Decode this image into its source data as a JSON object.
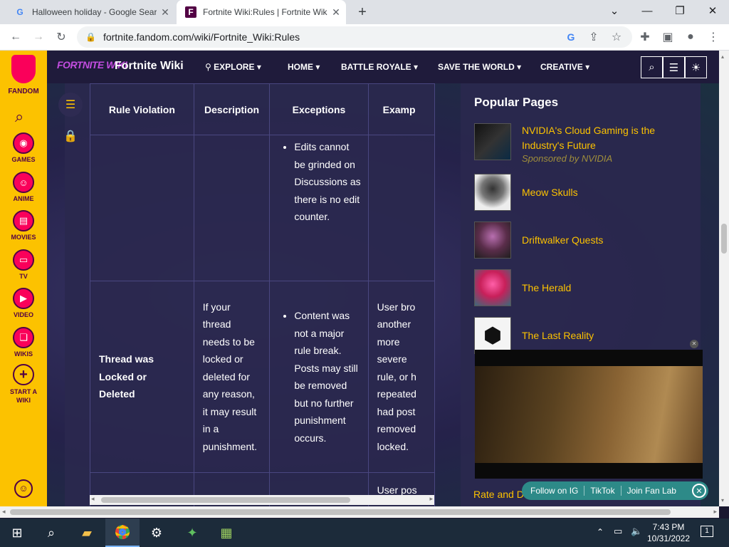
{
  "browser": {
    "tabs": [
      {
        "label": "Halloween holiday - Google Sear",
        "icon": "G"
      },
      {
        "label": "Fortnite Wiki:Rules | Fortnite Wik",
        "icon": "F"
      }
    ],
    "new_tab": "+",
    "url": "fortnite.fandom.com/wiki/Fortnite_Wiki:Rules"
  },
  "fandom_rail": {
    "logo_label": "FANDOM",
    "items": [
      {
        "label": "GAMES",
        "icon": "gamepad-icon"
      },
      {
        "label": "ANIME",
        "icon": "anime-icon"
      },
      {
        "label": "MOVIES",
        "icon": "film-icon"
      },
      {
        "label": "TV",
        "icon": "tv-icon"
      },
      {
        "label": "VIDEO",
        "icon": "play-icon"
      },
      {
        "label": "WIKIS",
        "icon": "book-icon"
      },
      {
        "label": "START A WIKI",
        "icon": "plus-icon"
      }
    ]
  },
  "wiki_header": {
    "logo_text": "FORTNITE WIKI",
    "title": "Fortnite Wiki",
    "nav": [
      "EXPLORE",
      "HOME",
      "BATTLE ROYALE",
      "SAVE THE WORLD",
      "CREATIVE"
    ]
  },
  "table": {
    "headers": [
      "Rule Violation",
      "Description",
      "Exceptions",
      "Examp"
    ],
    "row1": {
      "exceptions": [
        "Edits cannot be grinded on Discussions as there is no edit counter."
      ]
    },
    "row2": {
      "violation": "Thread was Locked or Deleted",
      "description": "If your thread needs to be locked or deleted for any reason, it may result in a punishment.",
      "exceptions": [
        "Content was not a major rule break. Posts may still be removed but no further punishment occurs."
      ],
      "example": "User bro another more severe rule, or h repeated had post removed locked."
    },
    "row3": {
      "example": "User pos"
    }
  },
  "popular": {
    "title": "Popular Pages",
    "items": [
      {
        "title": "NVIDIA's Cloud Gaming is the Industry's Future",
        "sponsor": "Sponsored by NVIDIA"
      },
      {
        "title": "Meow Skulls"
      },
      {
        "title": "Driftwalker Quests"
      },
      {
        "title": "The Herald"
      },
      {
        "title": "The Last Reality"
      }
    ],
    "partial_link": "Rate and D"
  },
  "social": {
    "follow_ig": "Follow on IG",
    "tiktok": "TikTok",
    "fan_lab": "Join Fan Lab"
  },
  "taskbar": {
    "time": "7:43 PM",
    "date": "10/31/2022",
    "notification_count": "1"
  }
}
